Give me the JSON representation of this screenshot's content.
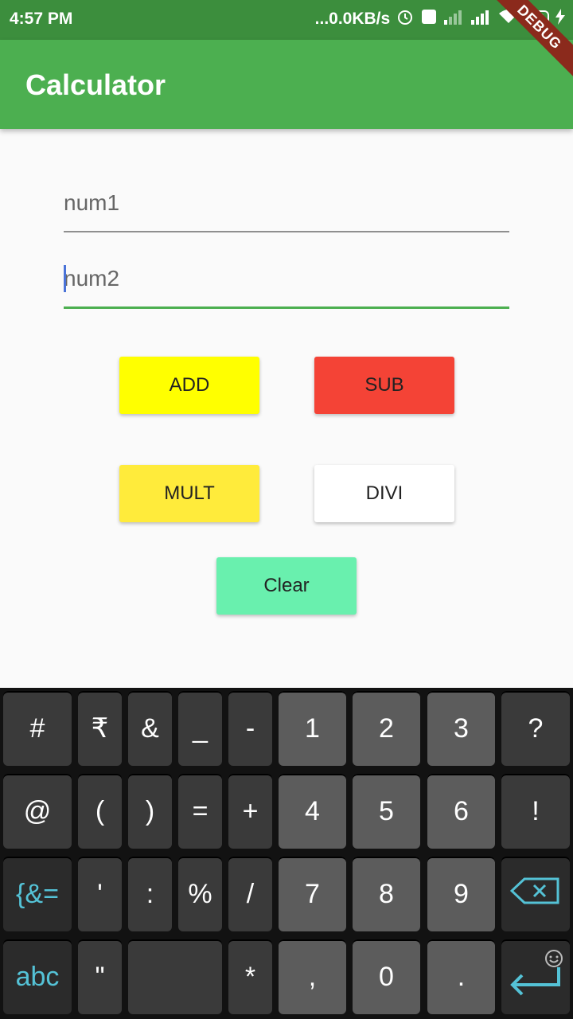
{
  "status_bar": {
    "time": "4:57 PM",
    "net_speed": "...0.0KB/s",
    "battery": "49"
  },
  "app_bar": {
    "title": "Calculator",
    "debug_label": "DEBUG"
  },
  "form": {
    "num1_placeholder": "num1",
    "num2_placeholder": "num2",
    "num1_value": "",
    "num2_value": ""
  },
  "buttons": {
    "add": "ADD",
    "sub": "SUB",
    "mult": "MULT",
    "divi": "DIVI",
    "clear": "Clear"
  },
  "colors": {
    "appbar": "#4caf50",
    "statusbar": "#3c8e3d",
    "add": "#ffff00",
    "sub": "#f44336",
    "mult": "#ffeb3b",
    "divi": "#ffffff",
    "clear": "#69f0ae"
  },
  "keyboard": {
    "row1": [
      "#",
      "₹",
      "&",
      "_",
      "-",
      "1",
      "2",
      "3",
      "?"
    ],
    "row2": [
      "@",
      "(",
      ")",
      "=",
      "+",
      "4",
      "5",
      "6",
      "!"
    ],
    "row3": [
      "{&=",
      "'",
      ":",
      "%",
      "/",
      "7",
      "8",
      "9"
    ],
    "row4": [
      "abc",
      "\"",
      "",
      "*",
      ",",
      "0",
      "."
    ]
  }
}
